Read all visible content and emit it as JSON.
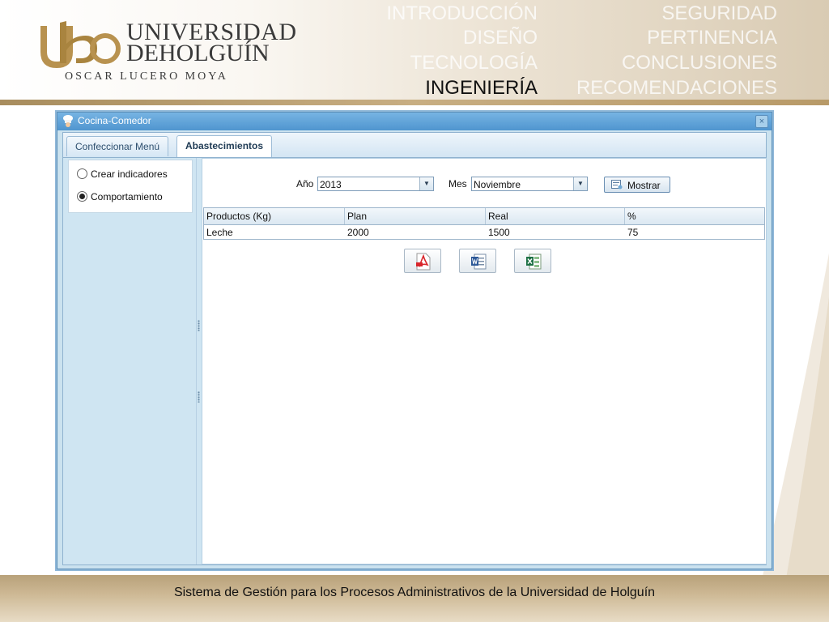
{
  "header": {
    "logo": {
      "line1": "UNIVERSIDAD",
      "line2": "DEHOLGUÍN",
      "subtitle": "OSCAR LUCERO MOYA"
    },
    "nav_left": [
      "INTRODUCCIÓN",
      "DISEÑO",
      "TECNOLOGÍA",
      "INGENIERÍA"
    ],
    "nav_right": [
      "SEGURIDAD",
      "PERTINENCIA",
      "CONCLUSIONES",
      "RECOMENDACIONES"
    ],
    "active": "INGENIERÍA"
  },
  "window": {
    "title": "Cocina-Comedor",
    "close_symbol": "×",
    "tabs": [
      "Confeccionar Menú",
      "Abastecimientos"
    ],
    "active_tab": "Abastecimientos",
    "options": [
      {
        "label": "Crear indicadores",
        "selected": false
      },
      {
        "label": "Comportamiento",
        "selected": true
      }
    ],
    "filters": {
      "year_label": "Año",
      "year_value": "2013",
      "month_label": "Mes",
      "month_value": "Noviembre",
      "show_button": "Mostrar"
    },
    "table": {
      "columns": [
        "Productos (Kg)",
        "Plan",
        "Real",
        "%"
      ],
      "rows": [
        [
          "Leche",
          "2000",
          "1500",
          "75"
        ]
      ]
    },
    "export_buttons": [
      "pdf-icon",
      "word-icon",
      "excel-icon"
    ]
  },
  "footer": {
    "text": "Sistema de Gestión para los Procesos Administrativos de la Universidad de Holguín"
  },
  "colors": {
    "accent_gold": "#b89a68",
    "window_blue": "#4f95cf",
    "nav_active": "#111111"
  }
}
